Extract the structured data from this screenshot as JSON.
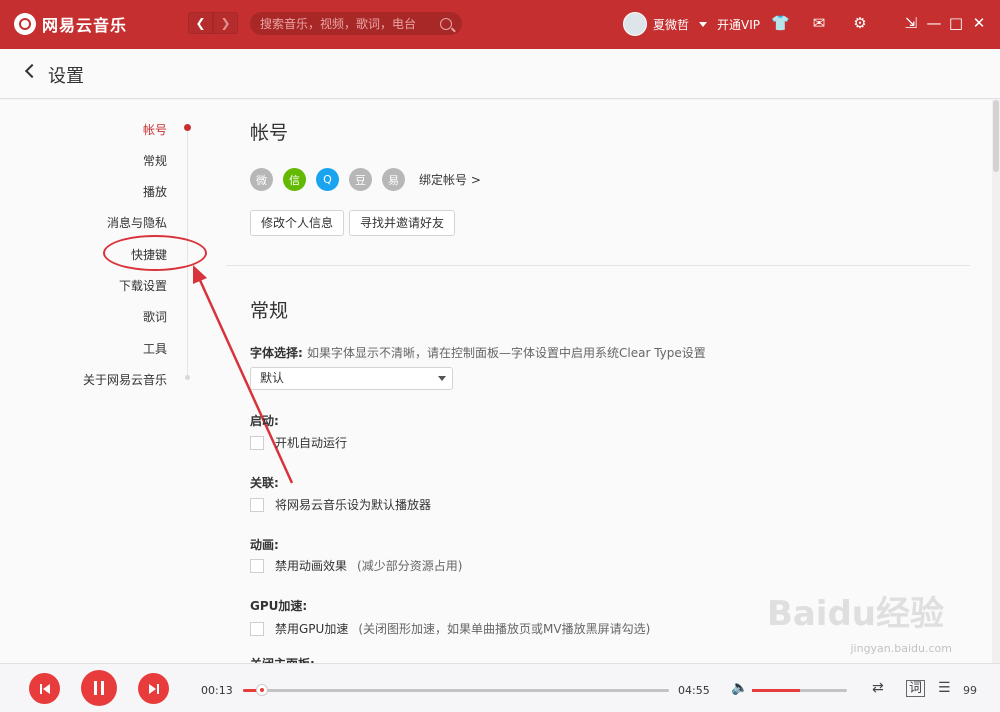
{
  "app": {
    "name": "网易云音乐"
  },
  "titlebar": {
    "search_placeholder": "搜索音乐，视频，歌词，电台",
    "username": "夏微哲",
    "vip_label": "开通VIP",
    "icons": [
      "skin-icon",
      "mail-icon",
      "gear-icon",
      "mini-mode-icon",
      "minimize-icon",
      "maximize-icon",
      "close-icon"
    ]
  },
  "page": {
    "title": "设置"
  },
  "sidebar": {
    "items": [
      {
        "label": "帐号",
        "active": true
      },
      {
        "label": "常规"
      },
      {
        "label": "播放"
      },
      {
        "label": "消息与隐私"
      },
      {
        "label": "快捷键"
      },
      {
        "label": "下载设置"
      },
      {
        "label": "歌词"
      },
      {
        "label": "工具"
      },
      {
        "label": "关于网易云音乐"
      }
    ]
  },
  "account": {
    "title": "帐号",
    "bind_link": "绑定帐号 >",
    "share_icons": [
      {
        "name": "weibo-icon",
        "glyph": "微",
        "color": "#b7b7b7"
      },
      {
        "name": "wechat-icon",
        "glyph": "信",
        "color": "#62b900"
      },
      {
        "name": "qq-icon",
        "glyph": "Q",
        "color": "#1aa4f0"
      },
      {
        "name": "douban-icon",
        "glyph": "豆",
        "color": "#b7b7b7"
      },
      {
        "name": "netease-icon",
        "glyph": "易",
        "color": "#b7b7b7"
      }
    ],
    "edit_profile_button": "修改个人信息",
    "find_friends_button": "寻找并邀请好友"
  },
  "general": {
    "title": "常规",
    "font_label": "字体选择:",
    "font_note": "如果字体显示不清晰，请在控制面板—字体设置中启用系统Clear Type设置",
    "font_value": "默认",
    "startup_label": "启动:",
    "startup_option": "开机自动运行",
    "assoc_label": "关联:",
    "assoc_option": "将网易云音乐设为默认播放器",
    "anim_label": "动画:",
    "anim_option": "禁用动画效果",
    "anim_note": "(减少部分资源占用)",
    "gpu_label": "GPU加速:",
    "gpu_option": "禁用GPU加速",
    "gpu_note": "(关闭图形加速，如果单曲播放页或MV播放黑屏请勾选)",
    "close_label": "关闭主面板:"
  },
  "player": {
    "current_time": "00:13",
    "total_time": "04:55",
    "progress": 0.045,
    "volume": 0.5,
    "lyric_label": "词",
    "playlist_count": "99"
  },
  "watermark": {
    "text": "Baidu经验",
    "url": "jingyan.baidu.com"
  },
  "colors": {
    "brand_red": "#c62f2f",
    "accent": "#e83c3c"
  }
}
